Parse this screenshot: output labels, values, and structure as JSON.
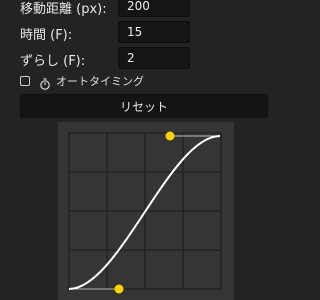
{
  "fields": {
    "distance": {
      "label": "移動距離 (px):",
      "value": "200"
    },
    "time": {
      "label": "時間 (F):",
      "value": "15"
    },
    "shift": {
      "label": "ずらし (F):",
      "value": "2"
    }
  },
  "auto_timing": {
    "label": "オートタイミング",
    "checked": false,
    "icon": "timer-icon"
  },
  "reset_button": {
    "label": "リセット"
  },
  "curve_editor": {
    "grid_divisions": 4,
    "colors": {
      "background": "#353535",
      "grid": "#232323",
      "curve": "#ffffff",
      "handle": "#ffd500",
      "handle_line": "#bdbdbd"
    }
  }
}
